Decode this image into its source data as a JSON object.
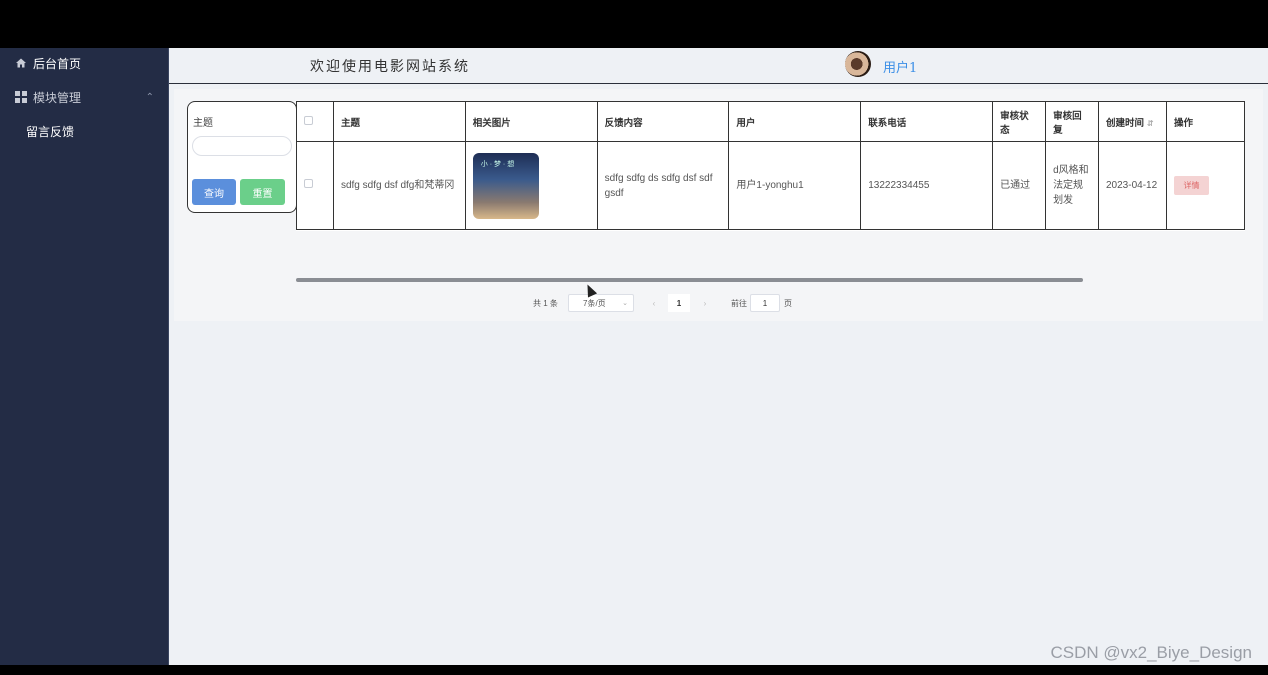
{
  "sidebar": {
    "home_label": "后台首页",
    "module_label": "模块管理",
    "feedback_label": "留言反馈"
  },
  "header": {
    "title": "欢迎使用电影网站系统",
    "user_name": "用户1"
  },
  "search": {
    "label": "主题",
    "value": "",
    "query_button": "查询",
    "reset_button": "重置"
  },
  "table": {
    "columns": [
      "主题",
      "相关图片",
      "反馈内容",
      "用户",
      "联系电话",
      "审核状态",
      "审核回复",
      "创建时间",
      "操作"
    ],
    "rows": [
      {
        "subject": "sdfg sdfg dsf dfg和梵蒂冈",
        "content": "sdfg sdfg ds sdfg dsf sdf gsdf",
        "user": "用户1-yonghu1",
        "phone": "13222334455",
        "status": "已通过",
        "reply": "d风格和法定规划发",
        "created": "2023-04-12",
        "action": "详情"
      }
    ]
  },
  "pagination": {
    "total": "共 1 条",
    "page_size": "7条/页",
    "current_page": "1",
    "goto_label": "前往",
    "goto_value": "1",
    "page_unit": "页"
  },
  "watermark": "CSDN @vx2_Biye_Design"
}
